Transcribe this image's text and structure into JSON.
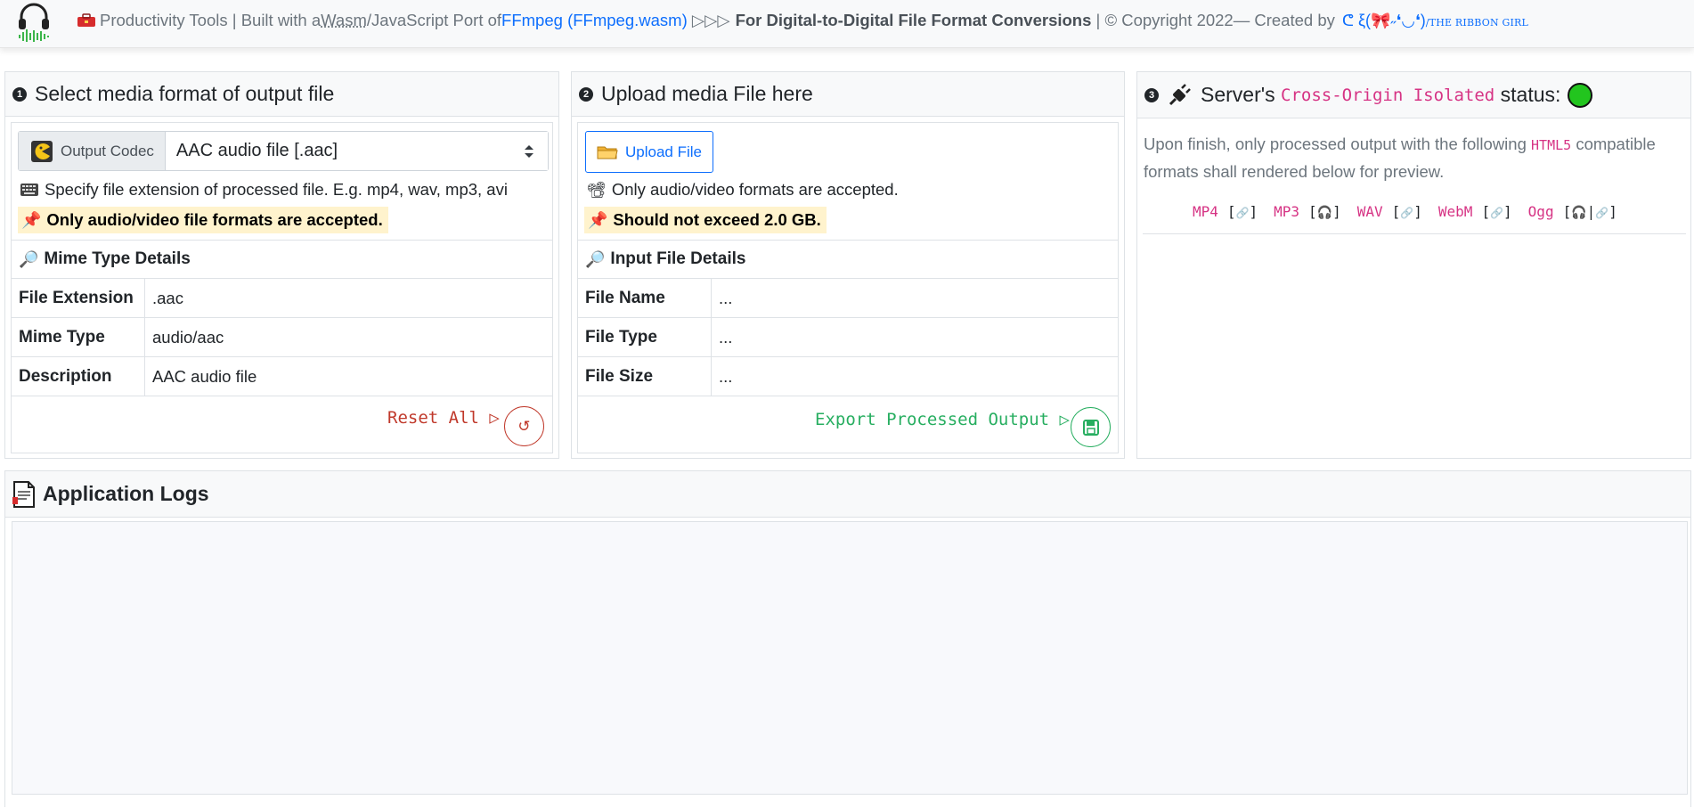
{
  "nav": {
    "title_prefix": "Productivity Tools | Built with a ",
    "wasm_abbr": "Wasm",
    "port_text": "/JavaScript Port of ",
    "ffmpeg_link": "FFmpeg",
    "ffmpeg_wasm_link": "(FFmpeg.wasm)",
    "arrows": "▷▷▷",
    "bold_text": "For Digital-to-Digital File Format Conversions",
    "copyright": "| © Copyright 2022— Created by",
    "ribbon_face": "ᕦ ξ(🎀˶❛◡❛)",
    "ribbon_name": "/THE RIBBON GIRL"
  },
  "panel1": {
    "number": "1",
    "title": "Select media format of output file",
    "codec_label": "Output Codec",
    "codec_selected": "AAC audio file [.aac]",
    "hint": "Specify file extension of processed file. E.g. mp4, wav, mp3, avi",
    "warning": "Only audio/video file formats are accepted.",
    "details_title": "Mime Type Details",
    "rows": [
      {
        "key": "File Extension",
        "value": ".aac"
      },
      {
        "key": "Mime Type",
        "value": "audio/aac"
      },
      {
        "key": "Description",
        "value": "AAC audio file"
      }
    ],
    "reset_label": "Reset All ▷"
  },
  "panel2": {
    "number": "2",
    "title": "Upload media File here",
    "upload_label": "Upload File",
    "hint": "Only audio/video formats are accepted.",
    "warning": "Should not exceed 2.0 GB.",
    "details_title": "Input File Details",
    "rows": [
      {
        "key": "File Name",
        "value": "..."
      },
      {
        "key": "File Type",
        "value": "..."
      },
      {
        "key": "File Size",
        "value": "..."
      }
    ],
    "export_label": "Export Processed Output ▷"
  },
  "panel3": {
    "number": "3",
    "title_prefix": "Server's",
    "title_code": "Cross-Origin Isolated",
    "title_suffix": "status:",
    "status_color": "#22c51e",
    "desc_part1": "Upon finish, only processed output with the following",
    "desc_code": "HTML5",
    "desc_part2": "compatible formats shall rendered below for preview.",
    "formats": [
      {
        "name": "MP4",
        "marks": [
          "🔗"
        ]
      },
      {
        "name": "MP3",
        "marks": [
          "🎧"
        ]
      },
      {
        "name": "WAV",
        "marks": [
          "🔗"
        ]
      },
      {
        "name": "WebM",
        "marks": [
          "🔗"
        ]
      },
      {
        "name": "Ogg",
        "marks": [
          "🎧",
          "🔗"
        ]
      }
    ]
  },
  "logs": {
    "title": "Application Logs"
  },
  "colors": {
    "reset": "#c0392b",
    "export": "#27ae60",
    "link": "#0d6efd",
    "code": "#d63384"
  }
}
